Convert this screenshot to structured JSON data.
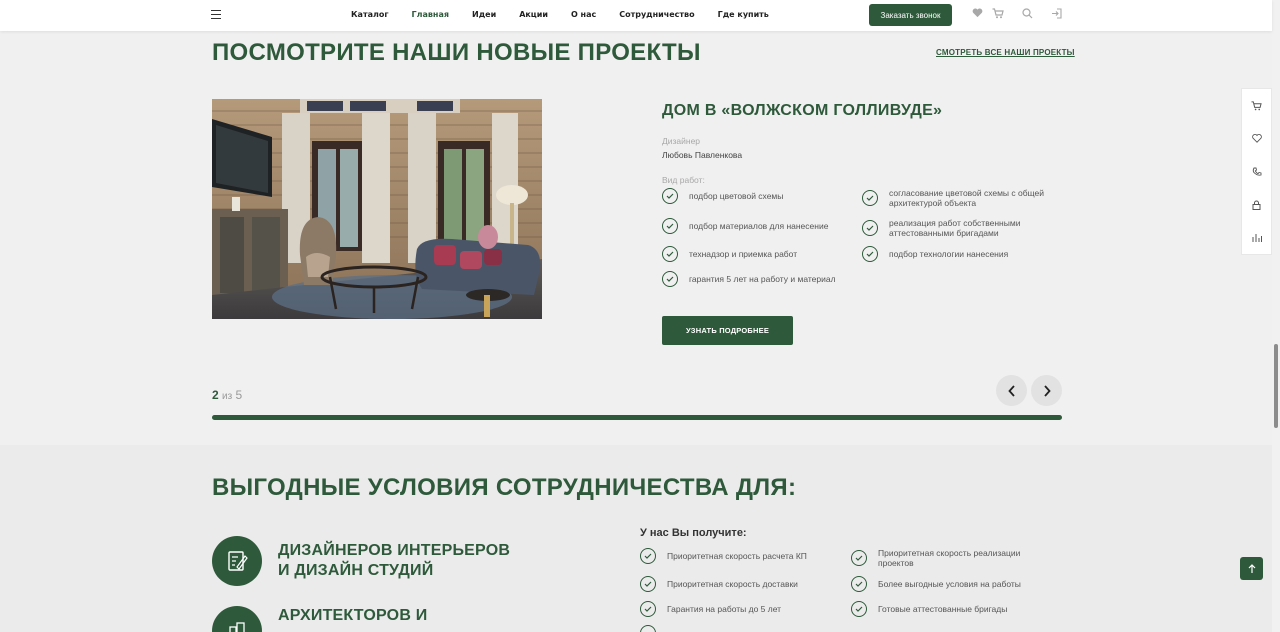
{
  "header": {
    "nav": [
      "Каталог",
      "Главная",
      "Идеи",
      "Акции",
      "О нас",
      "Сотрудничество",
      "Где купить"
    ],
    "active_index": 1,
    "call_button": "Заказать звонок",
    "icons": [
      "heart-icon",
      "cart-icon",
      "search-icon",
      "login-icon"
    ]
  },
  "projects": {
    "title": "ПОСМОТРИТЕ НАШИ НОВЫЕ ПРОЕКТЫ",
    "see_all": "СМОТРЕТЬ ВСЕ НАШИ ПРОЕКТЫ",
    "project_title": "ДОМ В «ВОЛЖСКОМ ГОЛЛИВУДЕ»",
    "designer_label": "Дизайнер",
    "designer_name": "Любовь Павленкова",
    "works_label": "Вид работ:",
    "works": [
      "подбор цветовой схемы",
      "согласование цветовой схемы с общей архитектурой объекта",
      "подбор материалов для нанесение",
      "реализация работ собственными аттестованными бригадами",
      "технадзор и приемка работ",
      "подбор технологии нанесения",
      "гарантия 5 лет на работу и материал"
    ],
    "more_button": "УЗНАТЬ ПОДРОБНЕЕ",
    "pager": {
      "current": "2",
      "sep": "из",
      "total": "5"
    },
    "progress": 1.0
  },
  "partnership": {
    "title": "ВЫГОДНЫЕ УСЛОВИЯ СОТРУДНИЧЕСТВА ДЛЯ:",
    "audiences": [
      "ДИЗАЙНЕРОВ ИНТЕРЬЕРОВ И ДИЗАЙН СТУДИЙ",
      "АРХИТЕКТОРОВ И"
    ],
    "benefits_title": "У нас Вы получите:",
    "benefits": [
      "Приоритетная скорость расчета КП",
      "Приоритетная скорость реализации проектов",
      "Приоритетная скорость доставки",
      "Более выгодные условия на работы",
      "Гарантия на работы до 5 лет",
      "Готовые аттестованные бригады"
    ]
  },
  "sidebar": [
    "cart-icon",
    "heart-icon",
    "phone-icon",
    "lock-icon",
    "compare-icon"
  ],
  "colors": {
    "brand": "#2e5a3b",
    "background": "#f0f0f0"
  }
}
